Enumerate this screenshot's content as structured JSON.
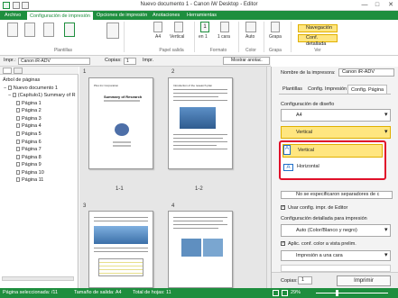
{
  "window": {
    "title": "Nuevo documento 1 - Canon iW Desktop - Editor",
    "minimize": "—",
    "maximize": "□",
    "close": "✕"
  },
  "menu": {
    "tabs": [
      "Archivo",
      "Configuración de impresión",
      "Opciones de impresión",
      "Anotaciones",
      "Herramientas"
    ]
  },
  "ribbon": {
    "labels": {
      "plantillas": "Plantillas",
      "papel_salida": "Papel salida",
      "formato": "Formato",
      "color": "Color",
      "grapa": "Grapa",
      "ver": "Ver"
    },
    "paper_size": "A4",
    "orientation": "Vertical",
    "pages_per_sheet": "1",
    "pages_label": "en 1",
    "sides": "1 cara",
    "color_mode": "Auto",
    "staple": "Grapa",
    "nav_button": "Navegación",
    "detail_button": "Conf. detallada"
  },
  "toolbar": {
    "printer_label": "Impr.:",
    "printer_value": "Canon iR-ADV",
    "copies_label": "Copias:",
    "copies_value": "1",
    "print_label": "Impr.",
    "show_annot": "Mostrar anotac."
  },
  "tree": {
    "root": "Árbol de páginas",
    "doc": "Nuevo documento 1",
    "chapter": "(Capítulo1) Summary of R",
    "pages": [
      "Página 1",
      "Página 2",
      "Página 3",
      "Página 4",
      "Página 5",
      "Página 6",
      "Página 7",
      "Página 8",
      "Página 9",
      "Página 10",
      "Página 11"
    ]
  },
  "pages_view": {
    "labels": [
      "1",
      "2",
      "3",
      "4"
    ],
    "captions": [
      "1-1",
      "1-2"
    ],
    "page1_title": "Summary of Research",
    "page1_company": "Plus Inc Corporation",
    "page2_header": "Introduction of the research plan"
  },
  "right_panel": {
    "printer_label": "Nombre de la impresora:",
    "printer_value": "Canon iR-ADV",
    "tabs": [
      "Plantillas",
      "Config. Impresión",
      "Config. Página"
    ],
    "layout_label": "Configuración de diseño",
    "layout_value": "A4",
    "orientation_value": "Vertical",
    "options": [
      "Vertical",
      "Horizontal"
    ],
    "separator_value": "No se especificaron separadores de c",
    "use_editor_label": "Usar config. impr. de Editor",
    "detail_label": "Configuración detallada para impresión",
    "color_value": "Auto (Color/Blanco y negro)",
    "apply_label": "Aplic. conf. color a vista prelim.",
    "sides_value": "Impresión a una cara",
    "copies_label": "Copias:",
    "copies_value": "1",
    "print_button": "Imprimir"
  },
  "status": {
    "selected": "Página seleccionada: /11",
    "output_size": "Tamaño de salida: A4",
    "total_sheets": "Total de hojas: 11",
    "zoom": "29%"
  },
  "colors": {
    "accent": "#1e8e3e",
    "highlight": "#ffe680",
    "outline": "#e0102a"
  }
}
